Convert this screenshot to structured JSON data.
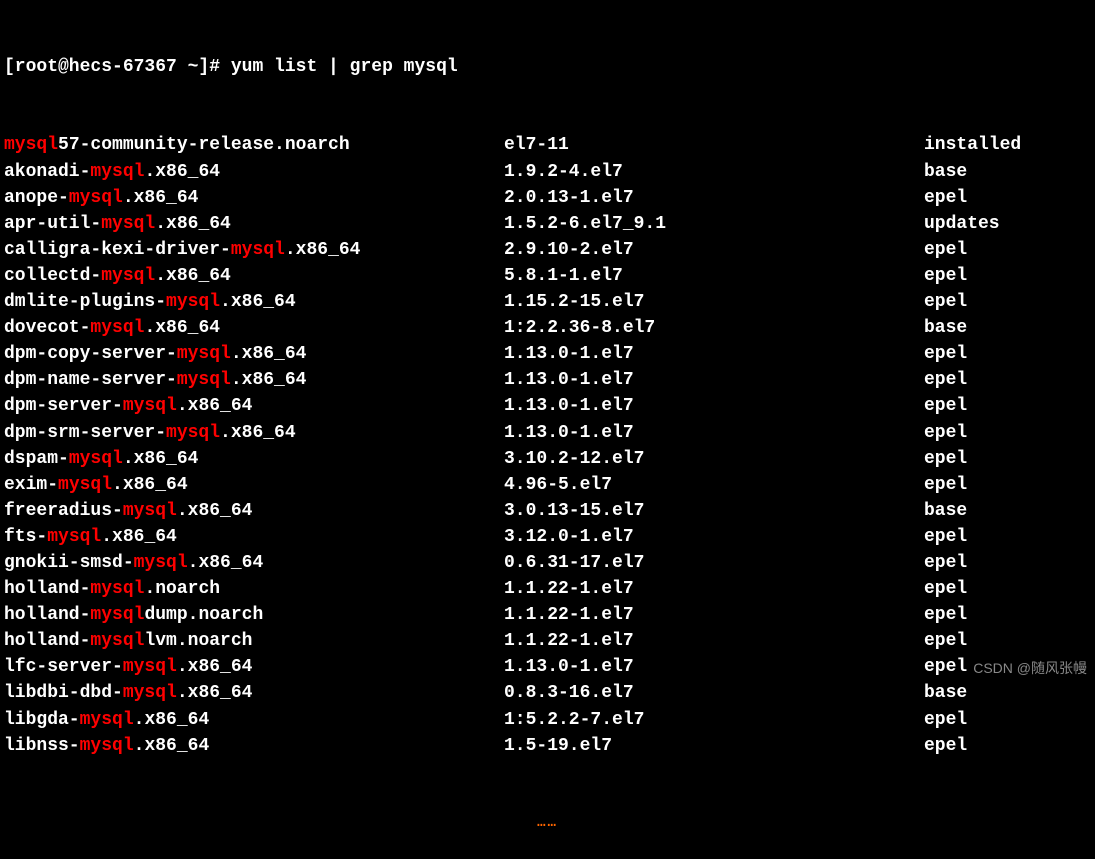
{
  "prompt": {
    "full": "[root@hecs-67367 ~]# ",
    "command": "yum list | grep mysql"
  },
  "highlight_term": "mysql",
  "packages": [
    {
      "name_pre": "",
      "name_hl": "mysql",
      "name_post": "57-community-release.noarch",
      "version": "el7-11",
      "repo": "installed"
    },
    {
      "name_pre": "akonadi-",
      "name_hl": "mysql",
      "name_post": ".x86_64",
      "version": "1.9.2-4.el7",
      "repo": "base"
    },
    {
      "name_pre": "anope-",
      "name_hl": "mysql",
      "name_post": ".x86_64",
      "version": "2.0.13-1.el7",
      "repo": "epel"
    },
    {
      "name_pre": "apr-util-",
      "name_hl": "mysql",
      "name_post": ".x86_64",
      "version": "1.5.2-6.el7_9.1",
      "repo": "updates"
    },
    {
      "name_pre": "calligra-kexi-driver-",
      "name_hl": "mysql",
      "name_post": ".x86_64",
      "version": "2.9.10-2.el7",
      "repo": "epel"
    },
    {
      "name_pre": "collectd-",
      "name_hl": "mysql",
      "name_post": ".x86_64",
      "version": "5.8.1-1.el7",
      "repo": "epel"
    },
    {
      "name_pre": "dmlite-plugins-",
      "name_hl": "mysql",
      "name_post": ".x86_64",
      "version": "1.15.2-15.el7",
      "repo": "epel"
    },
    {
      "name_pre": "dovecot-",
      "name_hl": "mysql",
      "name_post": ".x86_64",
      "version": "1:2.2.36-8.el7",
      "repo": "base"
    },
    {
      "name_pre": "dpm-copy-server-",
      "name_hl": "mysql",
      "name_post": ".x86_64",
      "version": "1.13.0-1.el7",
      "repo": "epel"
    },
    {
      "name_pre": "dpm-name-server-",
      "name_hl": "mysql",
      "name_post": ".x86_64",
      "version": "1.13.0-1.el7",
      "repo": "epel"
    },
    {
      "name_pre": "dpm-server-",
      "name_hl": "mysql",
      "name_post": ".x86_64",
      "version": "1.13.0-1.el7",
      "repo": "epel"
    },
    {
      "name_pre": "dpm-srm-server-",
      "name_hl": "mysql",
      "name_post": ".x86_64",
      "version": "1.13.0-1.el7",
      "repo": "epel"
    },
    {
      "name_pre": "dspam-",
      "name_hl": "mysql",
      "name_post": ".x86_64",
      "version": "3.10.2-12.el7",
      "repo": "epel"
    },
    {
      "name_pre": "exim-",
      "name_hl": "mysql",
      "name_post": ".x86_64",
      "version": "4.96-5.el7",
      "repo": "epel"
    },
    {
      "name_pre": "freeradius-",
      "name_hl": "mysql",
      "name_post": ".x86_64",
      "version": "3.0.13-15.el7",
      "repo": "base"
    },
    {
      "name_pre": "fts-",
      "name_hl": "mysql",
      "name_post": ".x86_64",
      "version": "3.12.0-1.el7",
      "repo": "epel"
    },
    {
      "name_pre": "gnokii-smsd-",
      "name_hl": "mysql",
      "name_post": ".x86_64",
      "version": "0.6.31-17.el7",
      "repo": "epel"
    },
    {
      "name_pre": "holland-",
      "name_hl": "mysql",
      "name_post": ".noarch",
      "version": "1.1.22-1.el7",
      "repo": "epel"
    },
    {
      "name_pre": "holland-",
      "name_hl": "mysql",
      "name_post": "dump.noarch",
      "version": "1.1.22-1.el7",
      "repo": "epel"
    },
    {
      "name_pre": "holland-",
      "name_hl": "mysql",
      "name_post": "lvm.noarch",
      "version": "1.1.22-1.el7",
      "repo": "epel"
    },
    {
      "name_pre": "lfc-server-",
      "name_hl": "mysql",
      "name_post": ".x86_64",
      "version": "1.13.0-1.el7",
      "repo": "epel"
    },
    {
      "name_pre": "libdbi-dbd-",
      "name_hl": "mysql",
      "name_post": ".x86_64",
      "version": "0.8.3-16.el7",
      "repo": "base"
    },
    {
      "name_pre": "libgda-",
      "name_hl": "mysql",
      "name_post": ".x86_64",
      "version": "1:5.2.2-7.el7",
      "repo": "epel"
    },
    {
      "name_pre": "libnss-",
      "name_hl": "mysql",
      "name_post": ".x86_64",
      "version": "1.5-19.el7",
      "repo": "epel"
    }
  ],
  "ellipsis": "……",
  "watermark": "CSDN @随风张幔"
}
